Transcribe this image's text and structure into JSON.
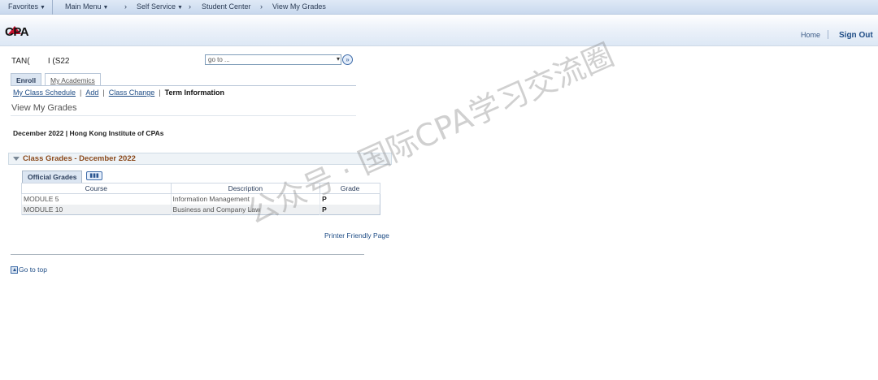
{
  "topnav": {
    "favorites": "Favorites",
    "main_menu": "Main Menu",
    "self_service": "Self Service",
    "student_center": "Student Center",
    "view_my_grades": "View My Grades"
  },
  "header": {
    "logo_text": "CPA",
    "home": "Home",
    "sign_out": "Sign Out"
  },
  "student": {
    "name_partial": "TAN(        I (S22"
  },
  "goto_select": {
    "selected": "go to ..."
  },
  "tabs": {
    "enroll": "Enroll",
    "my_academics": "My Academics"
  },
  "subnav": {
    "my_class_schedule": "My Class Schedule",
    "add": "Add",
    "class_change": "Class Change",
    "term_information": "Term Information"
  },
  "page": {
    "title": "View My Grades",
    "term_line": "December 2022 | Hong Kong Institute of CPAs",
    "section_title": "Class Grades - December 2022",
    "grid_tab": "Official Grades",
    "printer_friendly": "Printer Friendly Page",
    "go_to_top": "Go to top"
  },
  "grades_table": {
    "headers": [
      "Course",
      "Description",
      "Grade"
    ],
    "rows": [
      {
        "course": "MODULE 5",
        "description": "Information Management",
        "grade": "P"
      },
      {
        "course": "MODULE 10",
        "description": "Business and Company Law",
        "grade": "P"
      }
    ]
  },
  "watermark": "公众号 · 国际CPA学习交流圈"
}
